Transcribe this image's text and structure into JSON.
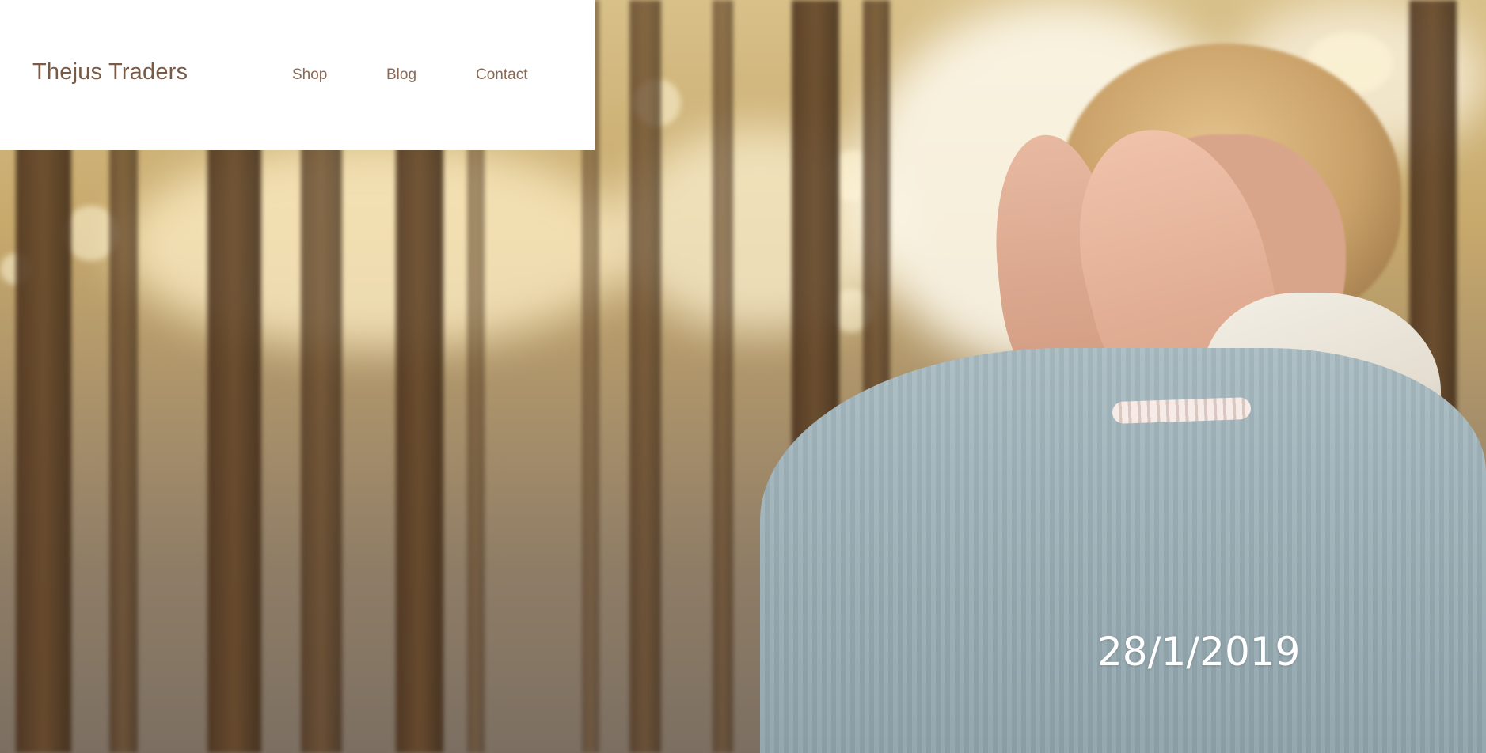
{
  "site": {
    "brand": "Thejus Traders",
    "nav": {
      "shop": "Shop",
      "blog": "Blog",
      "contact": "Contact"
    }
  },
  "hero": {
    "date": "28/1/2019",
    "image_subject": "woman-covering-face-in-forest-photo"
  },
  "colors": {
    "header_bg": "#ffffff",
    "brand_text": "#7a5a45",
    "nav_text": "#8b6a55",
    "date_text": "#ffffff"
  }
}
